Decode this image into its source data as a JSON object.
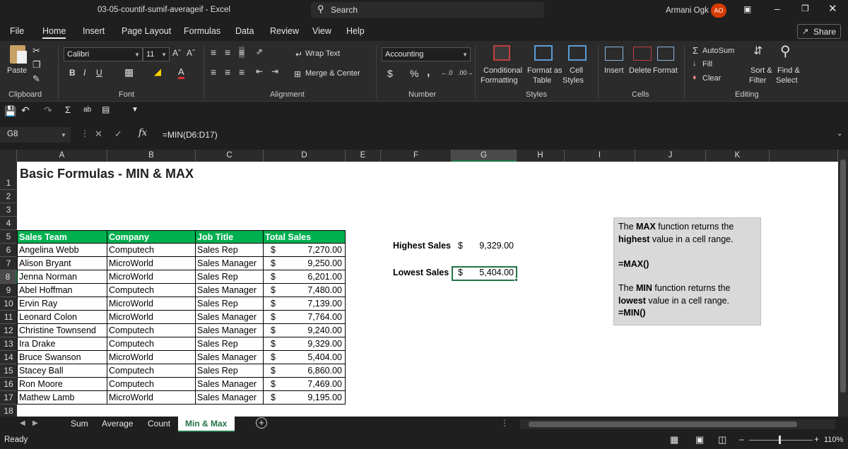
{
  "window": {
    "title": "03-05-countif-sumif-averageif  -  Excel",
    "search_placeholder": "Search",
    "user": "Armani Ogk",
    "user_initials": "AO"
  },
  "tabs": [
    "File",
    "Home",
    "Insert",
    "Page Layout",
    "Formulas",
    "Data",
    "Review",
    "View",
    "Help"
  ],
  "share_label": "Share",
  "ribbon": {
    "paste": "Paste",
    "font_name": "Calibri",
    "font_size": "11",
    "bold": "B",
    "italic": "I",
    "underline": "U",
    "wrap_text": "Wrap Text",
    "merge_center": "Merge & Center",
    "number_format": "Accounting",
    "currency": "$",
    "percent": "%",
    "comma": ",",
    "conditional": "Conditional",
    "formatting": "Formatting",
    "format_as": "Format as",
    "table": "Table",
    "cell": "Cell",
    "styles_btn": "Styles",
    "insert": "Insert",
    "delete": "Delete",
    "format": "Format",
    "autosum": "AutoSum",
    "fill": "Fill",
    "clear": "Clear",
    "sort_filter": "Sort &",
    "filter": "Filter",
    "find_select": "Find &",
    "select": "Select",
    "groups": {
      "clipboard": "Clipboard",
      "font": "Font",
      "alignment": "Alignment",
      "number": "Number",
      "styles": "Styles",
      "cells": "Cells",
      "editing": "Editing"
    }
  },
  "formula_bar": {
    "name_box": "G8",
    "fx": "fx",
    "formula": "=MIN(D6:D17)"
  },
  "columns": [
    "A",
    "B",
    "C",
    "D",
    "E",
    "F",
    "G",
    "H",
    "I",
    "J",
    "K"
  ],
  "rows": [
    "1",
    "2",
    "3",
    "4",
    "5",
    "6",
    "7",
    "8",
    "9",
    "10",
    "11",
    "12",
    "13",
    "14",
    "15",
    "16",
    "17",
    "18"
  ],
  "sheet": {
    "title": "Basic Formulas - MIN & MAX",
    "headers": [
      "Sales Team",
      "Company",
      "Job Title",
      "Total Sales"
    ],
    "data": [
      [
        "Angelina Webb",
        "Computech",
        "Sales Rep",
        "$",
        "7,270.00"
      ],
      [
        "Alison Bryant",
        "MicroWorld",
        "Sales Manager",
        "$",
        "9,250.00"
      ],
      [
        "Jenna Norman",
        "MicroWorld",
        "Sales Rep",
        "$",
        "6,201.00"
      ],
      [
        "Abel Hoffman",
        "Computech",
        "Sales Manager",
        "$",
        "7,480.00"
      ],
      [
        "Ervin Ray",
        "MicroWorld",
        "Sales Rep",
        "$",
        "7,139.00"
      ],
      [
        "Leonard Colon",
        "MicroWorld",
        "Sales Manager",
        "$",
        "7,764.00"
      ],
      [
        "Christine Townsend",
        "Computech",
        "Sales Manager",
        "$",
        "9,240.00"
      ],
      [
        "Ira Drake",
        "Computech",
        "Sales Rep",
        "$",
        "9,329.00"
      ],
      [
        "Bruce Swanson",
        "MicroWorld",
        "Sales Manager",
        "$",
        "5,404.00"
      ],
      [
        "Stacey Ball",
        "Computech",
        "Sales Rep",
        "$",
        "6,860.00"
      ],
      [
        "Ron Moore",
        "Computech",
        "Sales Manager",
        "$",
        "7,469.00"
      ],
      [
        "Mathew Lamb",
        "MicroWorld",
        "Sales Manager",
        "$",
        "9,195.00"
      ]
    ],
    "highest_label": "Highest Sales",
    "highest_cur": "$",
    "highest_value": "9,329.00",
    "lowest_label": "Lowest Sales",
    "lowest_cur": "$",
    "lowest_value": "5,404.00",
    "note": {
      "max_pre": "The ",
      "max_bold": "MAX",
      "max_post": " function returns the",
      "max_line2_bold": "highest",
      "max_line2": " value in a cell range.",
      "max_formula": "=MAX()",
      "min_pre": "The ",
      "min_bold": "MIN",
      "min_post": " function returns the",
      "min_line2_bold": "lowest",
      "min_line2": " value in a cell range.",
      "min_formula": "=MIN()"
    }
  },
  "sheetbar": {
    "sum": "Sum",
    "average": "Average",
    "count": "Count",
    "active_sheet": "Min & Max"
  },
  "status": {
    "ready": "Ready",
    "zoom": "110%"
  },
  "colors": {
    "header_green": "#00b050",
    "accent": "#217346",
    "avatar": "#d83b01"
  }
}
